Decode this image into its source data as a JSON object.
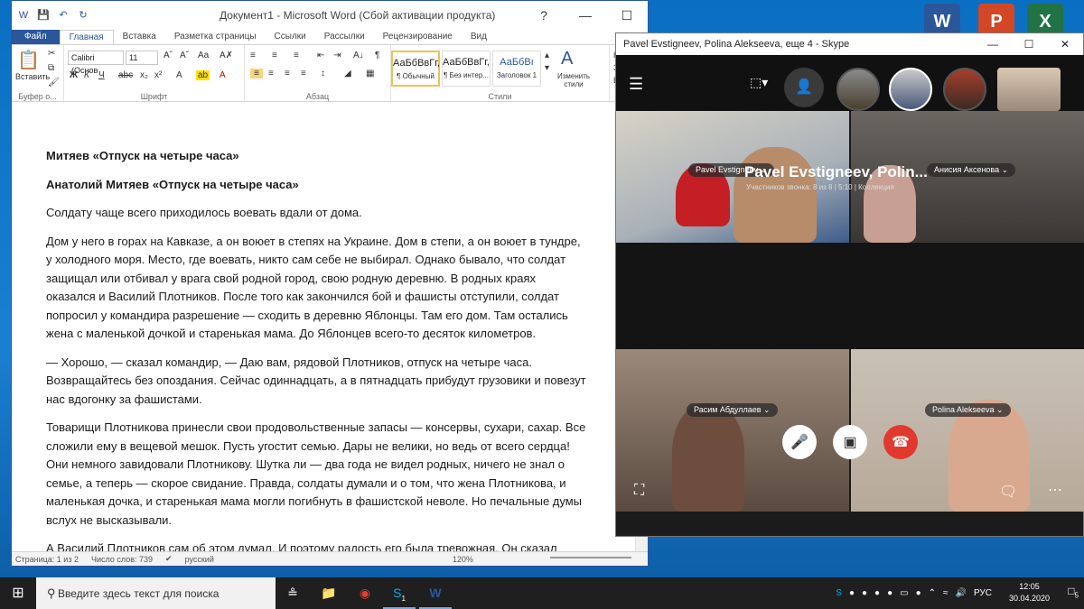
{
  "desktop": {
    "icons": [
      {
        "label": "W",
        "color": "#2b579a"
      },
      {
        "label": "P",
        "color": "#d24726"
      },
      {
        "label": "X",
        "color": "#217346"
      }
    ]
  },
  "word": {
    "title": "Документ1 - Microsoft Word (Сбой активации продукта)",
    "tabs": [
      "Файл",
      "Главная",
      "Вставка",
      "Разметка страницы",
      "Ссылки",
      "Рассылки",
      "Рецензирование",
      "Вид"
    ],
    "ribbon": {
      "paste_label": "Вставить",
      "clipboard_group": "Буфер о...",
      "font_name": "Calibri (Основ",
      "font_size": "11",
      "font_group": "Шрифт",
      "paragraph_group": "Абзац",
      "styles_group": "Стили",
      "styles": [
        {
          "sample": "АаБбВвГг,",
          "name": "¶ Обычный"
        },
        {
          "sample": "АаБбВвГг,",
          "name": "¶ Без интер..."
        },
        {
          "sample": "АаБбВı",
          "name": "Заголовок 1"
        }
      ],
      "change_styles": "Изменить стили",
      "edit_labels": [
        "На",
        "За",
        "Вы"
      ]
    },
    "document": {
      "paragraphs": [
        {
          "text": "Митяев «Отпуск на четыре часа»",
          "bold": true
        },
        {
          "text": "Анатолий Митяев «Отпуск на четыре часа»",
          "bold": true
        },
        {
          "text": "Солдату чаще всего приходилось воевать вдали от дома.",
          "bold": false
        },
        {
          "text": "Дом у него в горах на Кавказе, а он воюет в степях на Украине. Дом в степи, а он воюет в тундре, у холодного моря. Место, где воевать, никто сам себе не выбирал. Однако бывало, что солдат защищал или отбивал у врага свой родной город, свою родную деревню. В родных краях оказался и Василий Плотников. После того как закончился бой и фашисты отступили, солдат попросил у командира разрешение — сходить в деревню Яблонцы. Там его дом. Там остались жена с маленькой дочкой и старенькая мама. До Яблонцев всего-то десяток километров.",
          "bold": false
        },
        {
          "text": "— Хорошо, — сказал командир, — Даю вам, рядовой Плотников, отпуск на четыре часа. Возвращайтесь без опоздания. Сейчас одиннадцать, а в пятнадцать прибудут грузовики и повезут нас вдогонку за фашистами.",
          "bold": false
        },
        {
          "text": "Товарищи Плотникова принесли свои продовольственные запасы — консервы, сухари, сахар. Все сложили ему в вещевой мешок. Пусть угостит семью. Дары не велики, но ведь от всего сердца! Они немного завидовали Плотникову. Шутка ли — два года не видел родных, ничего не знал о семье, а теперь — скорое свидание. Правда, солдаты думали и о том, что жена Плотникова, и маленькая дочка, и старенькая мама могли погибнуть в фашистской неволе. Но печальные думы вслух не высказывали.",
          "bold": false
        },
        {
          "text": "А Василий Плотников сам об этом думал. И поэтому радость его была тревожная. Он сказал",
          "bold": false
        }
      ]
    },
    "status": {
      "page": "Страница: 1 из 2",
      "words": "Число слов: 739",
      "language": "русский",
      "zoom": "120%"
    }
  },
  "skype": {
    "title": "Pavel  Evstigneev, Polina Alekseeva, еще 4 - Skype",
    "call_title": "Pavel  Evstigneev, Polin...",
    "call_subtitle": "Участников звонка: 8 из 8  |  5:10  |  Коллекция",
    "participants": [
      {
        "name": "Pavel  Evstigneev"
      },
      {
        "name": "Анисия Аксенова"
      },
      {
        "name": "Расим Абдуллаев"
      },
      {
        "name": "Polina Alekseeva"
      }
    ]
  },
  "taskbar": {
    "search_placeholder": "Введите здесь текст для поиска",
    "language": "РУС",
    "time": "12:05",
    "date": "30.04.2020",
    "skype_badge": "1",
    "notif_count": "5"
  }
}
